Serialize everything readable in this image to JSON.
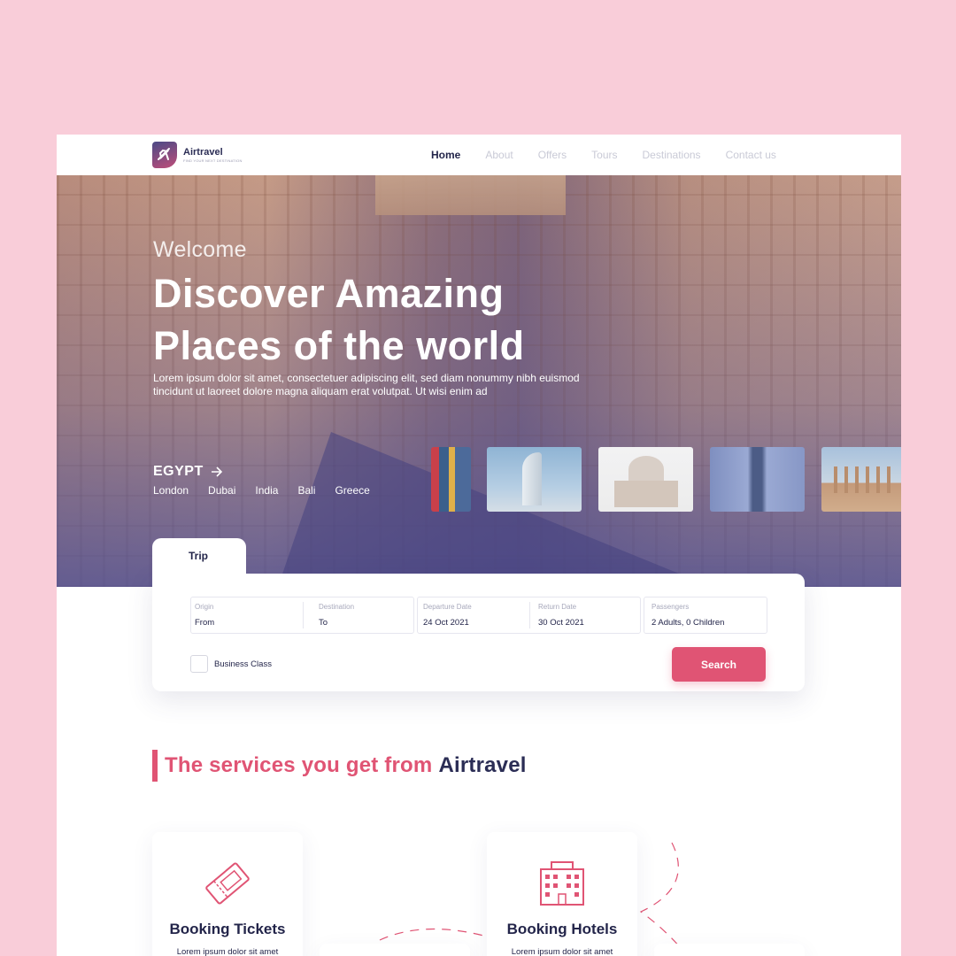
{
  "brand": {
    "name": "Airtravel",
    "tagline": "FIND YOUR NEXT DESTINATION"
  },
  "nav": {
    "items": [
      {
        "label": "Home",
        "active": true
      },
      {
        "label": "About",
        "active": false
      },
      {
        "label": "Offers",
        "active": false
      },
      {
        "label": "Tours",
        "active": false
      },
      {
        "label": "Destinations",
        "active": false
      },
      {
        "label": "Contact us",
        "active": false
      }
    ]
  },
  "hero": {
    "welcome": "Welcome",
    "headline_line1": "Discover Amazing",
    "headline_line2": "Places of the world",
    "description": "Lorem ipsum dolor sit amet, consectetuer adipiscing elit, sed diam nonummy nibh euismod tincidunt ut laoreet dolore magna aliquam erat volutpat. Ut wisi enim ad",
    "country": "EGYPT",
    "places": [
      "London",
      "Dubai",
      "India",
      "Bali",
      "Greece"
    ]
  },
  "booking": {
    "tab": "Trip",
    "fields": {
      "origin": {
        "label": "Origin",
        "value": "From"
      },
      "destination": {
        "label": "Destination",
        "value": "To"
      },
      "departure": {
        "label": "Departure Date",
        "value": "24 Oct 2021"
      },
      "return": {
        "label": "Return Date",
        "value": "30 Oct 2021"
      },
      "passengers": {
        "label": "Passengers",
        "value": "2 Adults, 0 Children"
      }
    },
    "business_class": "Business Class",
    "search": "Search"
  },
  "services": {
    "title_part1": "The services you get from",
    "title_part2": "Airtravel",
    "cards": [
      {
        "title": "Booking Tickets",
        "text": "Lorem ipsum dolor sit amet",
        "icon": "ticket-icon"
      },
      {
        "title": "Booking Hotels",
        "text": "Lorem ipsum dolor sit amet",
        "icon": "hotel-icon"
      }
    ]
  },
  "colors": {
    "accent": "#e05474",
    "navy": "#23254a",
    "background": "#f9cdd9"
  }
}
